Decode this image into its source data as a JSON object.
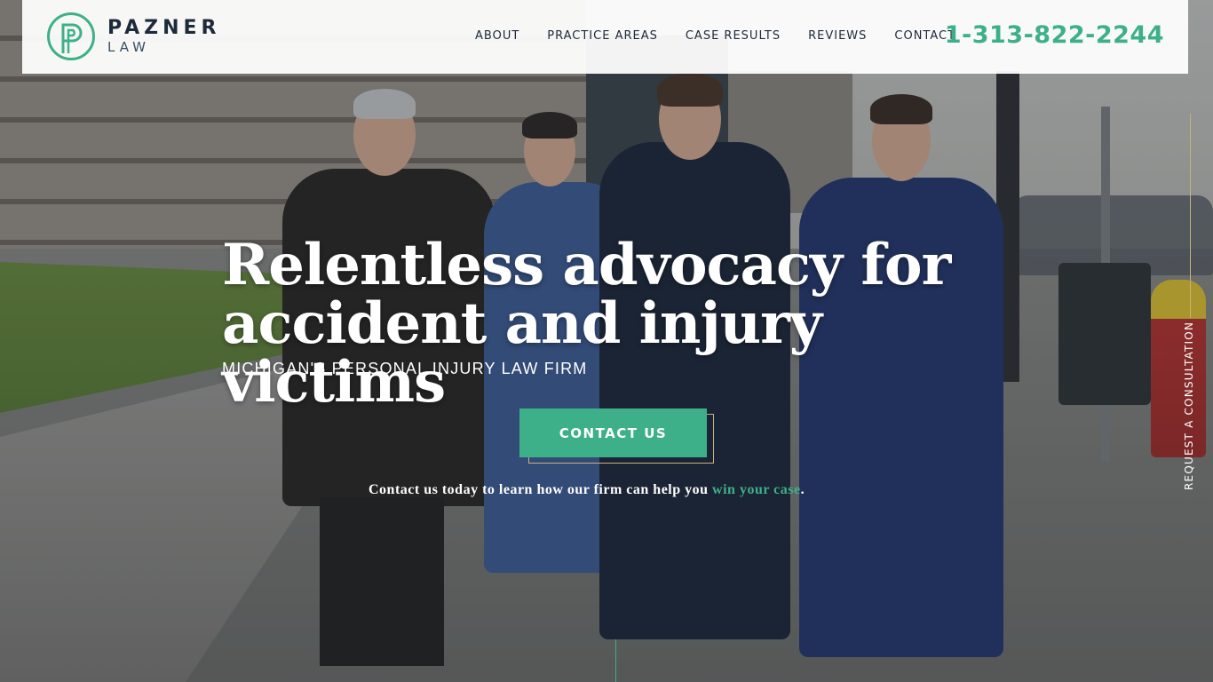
{
  "brand": {
    "name": "PAZNER",
    "subtitle": "LAW",
    "accent_color": "#3db08a"
  },
  "nav": {
    "items": [
      {
        "label": "ABOUT"
      },
      {
        "label": "PRACTICE AREAS"
      },
      {
        "label": "CASE RESULTS"
      },
      {
        "label": "REVIEWS"
      },
      {
        "label": "CONTACT"
      }
    ],
    "phone": "1-313-822-2244"
  },
  "hero": {
    "headline_line1": "Relentless advocacy for",
    "headline_line2": "accident and injury victims",
    "subheadline": "MICHIGAN'S PERSONAL INJURY LAW FIRM",
    "cta_label": "CONTACT US",
    "tagline_prefix": "Contact us today to learn how our firm can help you ",
    "tagline_link": "win your case",
    "tagline_suffix": "."
  },
  "side_cta": {
    "label": "REQUEST A CONSULTATION"
  }
}
